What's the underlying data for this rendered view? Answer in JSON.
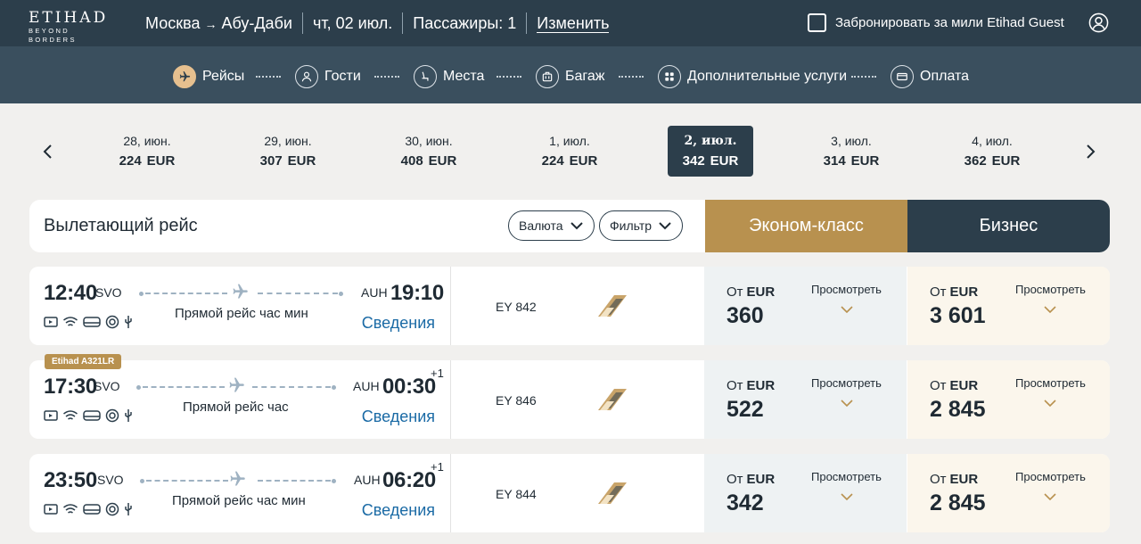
{
  "header": {
    "logo_main": "ETIHAD",
    "logo_sub": "BEYOND BORDERS",
    "route_from": "Москва",
    "route_arrow": "→",
    "route_to": "Абу-Даби",
    "date": "чт, 02 июл.",
    "passengers": "Пассажиры: 1",
    "change": "Изменить",
    "miles_label": "Забронировать за мили Etihad Guest"
  },
  "steps": [
    {
      "label": "Рейсы",
      "icon": "plane-icon"
    },
    {
      "label": "Гости",
      "icon": "user-icon"
    },
    {
      "label": "Места",
      "icon": "seat-icon"
    },
    {
      "label": "Багаж",
      "icon": "baggage-icon"
    },
    {
      "label": "Дополнительные услуги",
      "icon": "grid-icon"
    },
    {
      "label": "Оплата",
      "icon": "card-icon"
    }
  ],
  "dates": [
    {
      "label": "28, июн.",
      "price": "224",
      "cur": "EUR"
    },
    {
      "label": "29, июн.",
      "price": "307",
      "cur": "EUR"
    },
    {
      "label": "30, июн.",
      "price": "408",
      "cur": "EUR"
    },
    {
      "label": "1, июл.",
      "price": "224",
      "cur": "EUR"
    },
    {
      "label": "2, июл.",
      "price": "342",
      "cur": "EUR"
    },
    {
      "label": "3, июл.",
      "price": "314",
      "cur": "EUR"
    },
    {
      "label": "4, июл.",
      "price": "362",
      "cur": "EUR"
    }
  ],
  "filter": {
    "title": "Вылетающий рейс",
    "currency": "Валюта",
    "filter": "Фильтр",
    "economy": "Эконом-класс",
    "business": "Бизнес"
  },
  "common": {
    "details": "Сведения",
    "from": "От",
    "eur": "EUR",
    "view": "Просмотреть"
  },
  "flights": [
    {
      "dep_time": "12:40",
      "dep_code": "SVO",
      "arr_code": "AUH",
      "arr_time": "19:10",
      "plus_day": "",
      "nonstop": "Прямой рейс час мин",
      "flight_no": "EY 842",
      "badge": "",
      "eco_price": "360",
      "bus_price": "3 601"
    },
    {
      "dep_time": "17:30",
      "dep_code": "SVO",
      "arr_code": "AUH",
      "arr_time": "00:30",
      "plus_day": "+1",
      "nonstop": "Прямой рейс час",
      "flight_no": "EY 846",
      "badge": "Etihad A321LR",
      "eco_price": "522",
      "bus_price": "2 845"
    },
    {
      "dep_time": "23:50",
      "dep_code": "SVO",
      "arr_code": "AUH",
      "arr_time": "06:20",
      "plus_day": "+1",
      "nonstop": "Прямой рейс час мин",
      "flight_no": "EY 844",
      "badge": "",
      "eco_price": "342",
      "bus_price": "2 845"
    }
  ],
  "colors": {
    "header": "#2c3e4b",
    "steps_bg": "#3a4f5e",
    "economy": "#b8914f",
    "business": "#2c3e4b",
    "link": "#1a6aa5"
  }
}
